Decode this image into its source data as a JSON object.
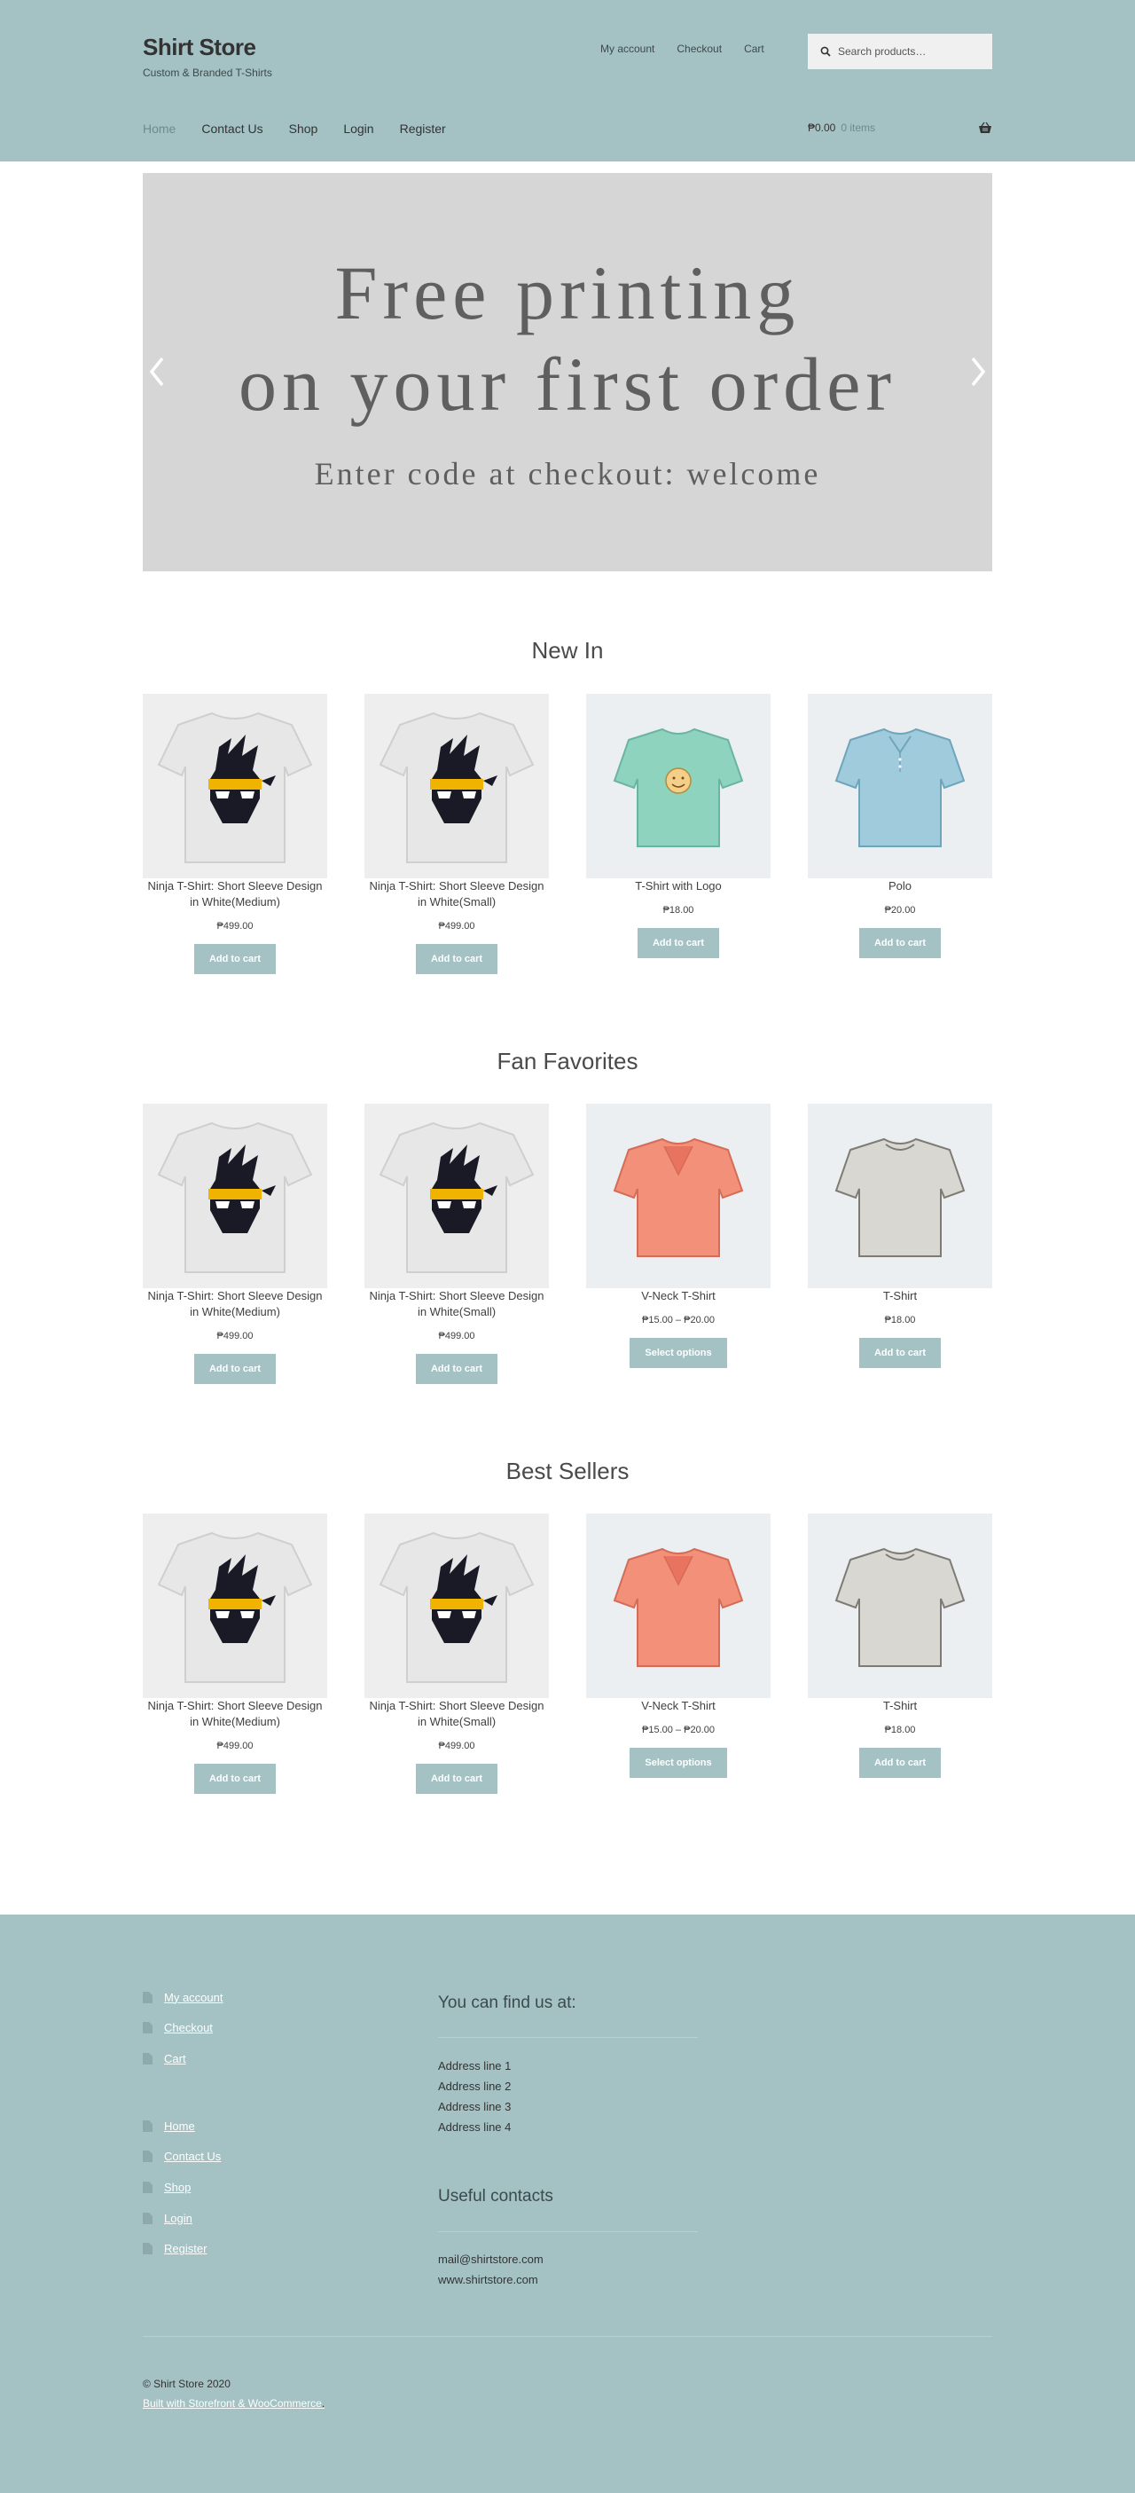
{
  "header": {
    "site_title": "Shirt Store",
    "tagline": "Custom & Branded T-Shirts",
    "secondary_nav": [
      "My account",
      "Checkout",
      "Cart"
    ],
    "search_placeholder": "Search products…",
    "primary_nav": [
      "Home",
      "Contact Us",
      "Shop",
      "Login",
      "Register"
    ],
    "active_nav": "Home",
    "cart_amount": "₱0.00",
    "cart_count": "0 items"
  },
  "hero": {
    "line1": "Free printing",
    "line2": "on your first order",
    "subtitle": "Enter code at checkout: welcome"
  },
  "sections": [
    {
      "title": "New In",
      "products": [
        {
          "name": "Ninja T-Shirt: Short Sleeve Design in White(Medium)",
          "price": "₱499.00",
          "button": "Add to cart",
          "image": "ninja-shirt"
        },
        {
          "name": "Ninja T-Shirt: Short Sleeve Design in White(Small)",
          "price": "₱499.00",
          "button": "Add to cart",
          "image": "ninja-shirt"
        },
        {
          "name": "T-Shirt with Logo",
          "price": "₱18.00",
          "button": "Add to cart",
          "image": "green-logo-shirt"
        },
        {
          "name": "Polo",
          "price": "₱20.00",
          "button": "Add to cart",
          "image": "blue-polo"
        }
      ]
    },
    {
      "title": "Fan Favorites",
      "products": [
        {
          "name": "Ninja T-Shirt: Short Sleeve Design in White(Medium)",
          "price": "₱499.00",
          "button": "Add to cart",
          "image": "ninja-shirt"
        },
        {
          "name": "Ninja T-Shirt: Short Sleeve Design in White(Small)",
          "price": "₱499.00",
          "button": "Add to cart",
          "image": "ninja-shirt"
        },
        {
          "name": "V-Neck T-Shirt",
          "price": "₱15.00 – ₱20.00",
          "button": "Select options",
          "image": "orange-vneck"
        },
        {
          "name": "T-Shirt",
          "price": "₱18.00",
          "button": "Add to cart",
          "image": "gray-tshirt"
        }
      ]
    },
    {
      "title": "Best Sellers",
      "products": [
        {
          "name": "Ninja T-Shirt: Short Sleeve Design in White(Medium)",
          "price": "₱499.00",
          "button": "Add to cart",
          "image": "ninja-shirt"
        },
        {
          "name": "Ninja T-Shirt: Short Sleeve Design in White(Small)",
          "price": "₱499.00",
          "button": "Add to cart",
          "image": "ninja-shirt"
        },
        {
          "name": "V-Neck T-Shirt",
          "price": "₱15.00 – ₱20.00",
          "button": "Select options",
          "image": "orange-vneck"
        },
        {
          "name": "T-Shirt",
          "price": "₱18.00",
          "button": "Add to cart",
          "image": "gray-tshirt"
        }
      ]
    }
  ],
  "footer": {
    "menu_account": [
      "My account",
      "Checkout",
      "Cart"
    ],
    "menu_main": [
      "Home",
      "Contact Us",
      "Shop",
      "Login",
      "Register"
    ],
    "find_us_title": "You can find us at:",
    "address_lines": [
      "Address line 1",
      "Address line 2",
      "Address line 3",
      "Address line 4"
    ],
    "contacts_title": "Useful contacts",
    "contact_lines": [
      "mail@shirtstore.com",
      "www.shirtstore.com"
    ],
    "copyright": "© Shirt Store 2020",
    "credit": "Built with Storefront & WooCommerce",
    "credit_suffix": "."
  },
  "colors": {
    "header_bg": "#a4c1c4",
    "button_bg": "#a4c1c4",
    "hero_bg": "#d6d6d6",
    "text": "#404040"
  }
}
